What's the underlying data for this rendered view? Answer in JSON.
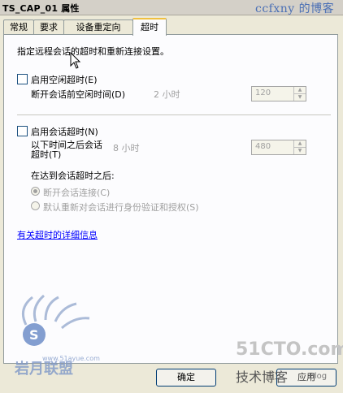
{
  "window": {
    "title": "TS_CAP_01 属性"
  },
  "watermark": "ccfxny 的博客",
  "tabs": [
    {
      "label": "常规",
      "active": false
    },
    {
      "label": "要求",
      "active": false
    },
    {
      "label": "设备重定向",
      "active": false
    },
    {
      "label": "超时",
      "active": true
    }
  ],
  "content": {
    "intro": "指定远程会话的超时和重新连接设置。",
    "idle": {
      "checkbox_label": "启用空闲超时(E)",
      "checked": false,
      "field_label": "断开会话前空闲时间(D)",
      "hint": "2 小时",
      "value": "120"
    },
    "session": {
      "checkbox_label": "启用会话超时(N)",
      "checked": false,
      "field_label_line1": "以下时间之后会话",
      "field_label_line2": "超时(T)",
      "hint": "8 小时",
      "value": "480",
      "after_label": "在达到会话超时之后:",
      "options": [
        {
          "label": "断开会话连接(C)",
          "selected": true
        },
        {
          "label": "默认重新对会话进行身份验证和授权(S)",
          "selected": false
        }
      ]
    },
    "more_info_link": "有关超时的详细信息"
  },
  "buttons": {
    "ok": "确定",
    "apply": "应用"
  },
  "logos": {
    "left_text": "岩月联盟",
    "left_sub": "www.51ayue.com",
    "right_main": "51CTO.com",
    "right_sub": "技术博客",
    "right_blog": "Blog"
  }
}
